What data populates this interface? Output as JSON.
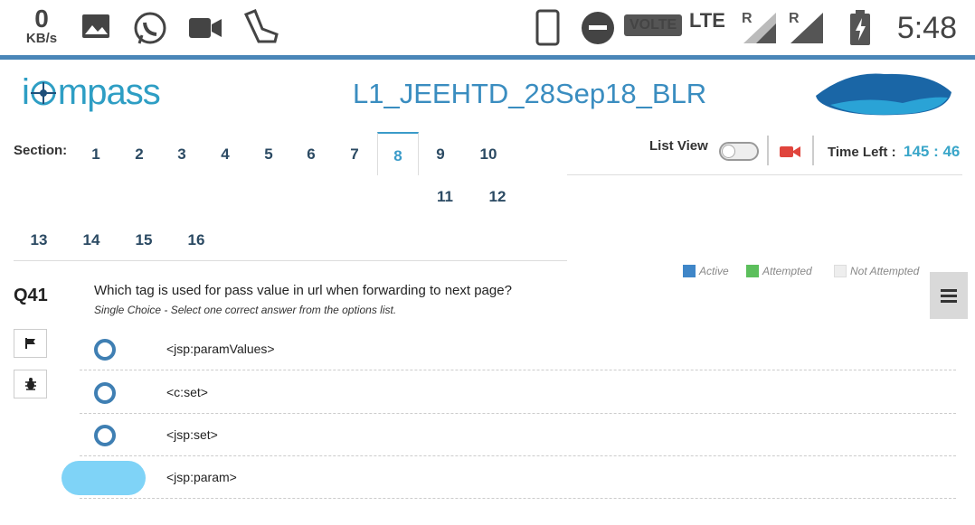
{
  "status_bar": {
    "speed_value": "0",
    "speed_unit": "KB/s",
    "network": "VOLTE",
    "lte": "LTE",
    "roaming_1": "R",
    "roaming_2": "R",
    "time": "5:48"
  },
  "header": {
    "logo_text_pre": "i",
    "logo_text_post": "mpass",
    "title": "L1_JEEHTD_28Sep18_BLR"
  },
  "sections": {
    "label": "Section:",
    "items": [
      "1",
      "2",
      "3",
      "4",
      "5",
      "6",
      "7",
      "8",
      "9",
      "10",
      "11",
      "12",
      "13",
      "14",
      "15",
      "16"
    ],
    "active": "8"
  },
  "controls": {
    "list_view_label": "List View",
    "time_left_label": "Time Left :",
    "time_left_value": "145 : 46"
  },
  "legend": {
    "active": "Active",
    "attempted": "Attempted",
    "not_attempted": "Not Attempted",
    "colors": {
      "active": "#3f86c8",
      "attempted": "#5cbf5c",
      "not_attempted": "#eeeeee"
    }
  },
  "question": {
    "number": "Q41",
    "text": "Which tag is used for pass value in url when forwarding to next page?",
    "instruction": "Single Choice - Select one correct answer from the options list.",
    "options": [
      "<jsp:paramValues>",
      "<c:set>",
      "<jsp:set>",
      "<jsp:param>"
    ]
  },
  "icons": {
    "flag": "flag-icon",
    "bug": "bug-icon",
    "menu": "hamburger-menu-icon",
    "camera": "video-camera-icon"
  }
}
